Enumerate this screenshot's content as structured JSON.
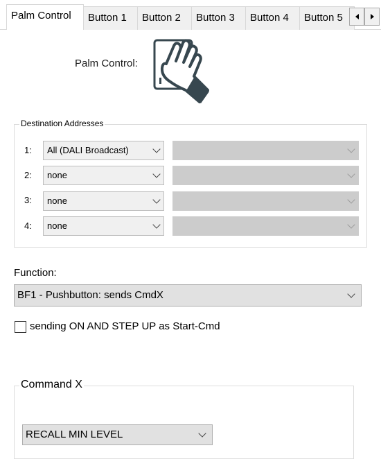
{
  "tabs": {
    "items": [
      {
        "label": "Palm Control",
        "active": true
      },
      {
        "label": "Button 1",
        "active": false
      },
      {
        "label": "Button 2",
        "active": false
      },
      {
        "label": "Button 3",
        "active": false
      },
      {
        "label": "Button 4",
        "active": false
      },
      {
        "label": "Button 5",
        "active": false
      }
    ],
    "scroll_left_icon": "triangle-left",
    "scroll_right_icon": "triangle-right"
  },
  "palm_control": {
    "label": "Palm Control:",
    "icon": "hand-palm-icon"
  },
  "destination_addresses": {
    "title": "Destination Addresses",
    "rows": [
      {
        "num": "1:",
        "address": "All (DALI Broadcast)",
        "detail": ""
      },
      {
        "num": "2:",
        "address": "none",
        "detail": ""
      },
      {
        "num": "3:",
        "address": "none",
        "detail": ""
      },
      {
        "num": "4:",
        "address": "none",
        "detail": ""
      }
    ]
  },
  "function": {
    "label": "Function:",
    "value": "BF1 - Pushbutton:  sends CmdX"
  },
  "start_cmd_checkbox": {
    "label": "sending ON AND STEP UP as Start-Cmd",
    "checked": false
  },
  "command_x": {
    "title": "Command X",
    "value": "RECALL MIN LEVEL"
  },
  "colors": {
    "tab_inactive_bg": "#f0f0f0",
    "combo_disabled_bg": "#cccccc",
    "border": "#d9d9d9"
  }
}
